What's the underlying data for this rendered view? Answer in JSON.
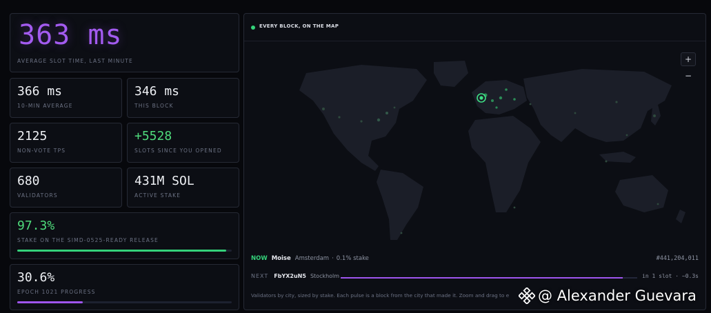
{
  "avg_slot": {
    "value": "363 ms",
    "label": "AVERAGE SLOT TIME, LAST MINUTE"
  },
  "stats": [
    {
      "value": "366 ms",
      "label": "10-MIN AVERAGE"
    },
    {
      "value": "346 ms",
      "label": "THIS BLOCK"
    },
    {
      "value": "2125",
      "label": "NON-VOTE TPS"
    },
    {
      "value": "+5528",
      "label": "SLOTS SINCE YOU OPENED"
    },
    {
      "value": "680",
      "label": "VALIDATORS"
    },
    {
      "value": "431M SOL",
      "label": "ACTIVE STAKE"
    }
  ],
  "stake_release": {
    "value": "97.3%",
    "label": "STAKE ON THE SIMD-0525-READY RELEASE",
    "progress": 0.973
  },
  "epoch": {
    "value": "30.6%",
    "label": "EPOCH 1021 PROGRESS",
    "progress": 0.306
  },
  "map": {
    "title": "EVERY BLOCK, ON THE MAP",
    "zoom_in": "+",
    "zoom_out": "−",
    "now": {
      "tag": "NOW",
      "validator": "Moise",
      "city": "Amsterdam",
      "separator": "·",
      "stake": "0.1% stake",
      "block": "#441,204,011"
    },
    "next": {
      "tag": "NEXT",
      "validator": "FbYX2uN5",
      "city": "Stockholm",
      "progress": 0.95,
      "eta": "in 1 slot",
      "separator": "·",
      "delta": "~0.3s"
    },
    "footnote": "Validators by city, sized by stake. Each pulse is a block from the city that made it. Zoom and drag to e"
  },
  "colors": {
    "accent_purple": "#a35bf0",
    "accent_green": "#34d27a",
    "background": "#07080c",
    "card": "#0c0e14",
    "land": "#1b1e28"
  },
  "watermark": {
    "icon": "binance-logo-icon",
    "text": "@ Alexander Guevara"
  }
}
